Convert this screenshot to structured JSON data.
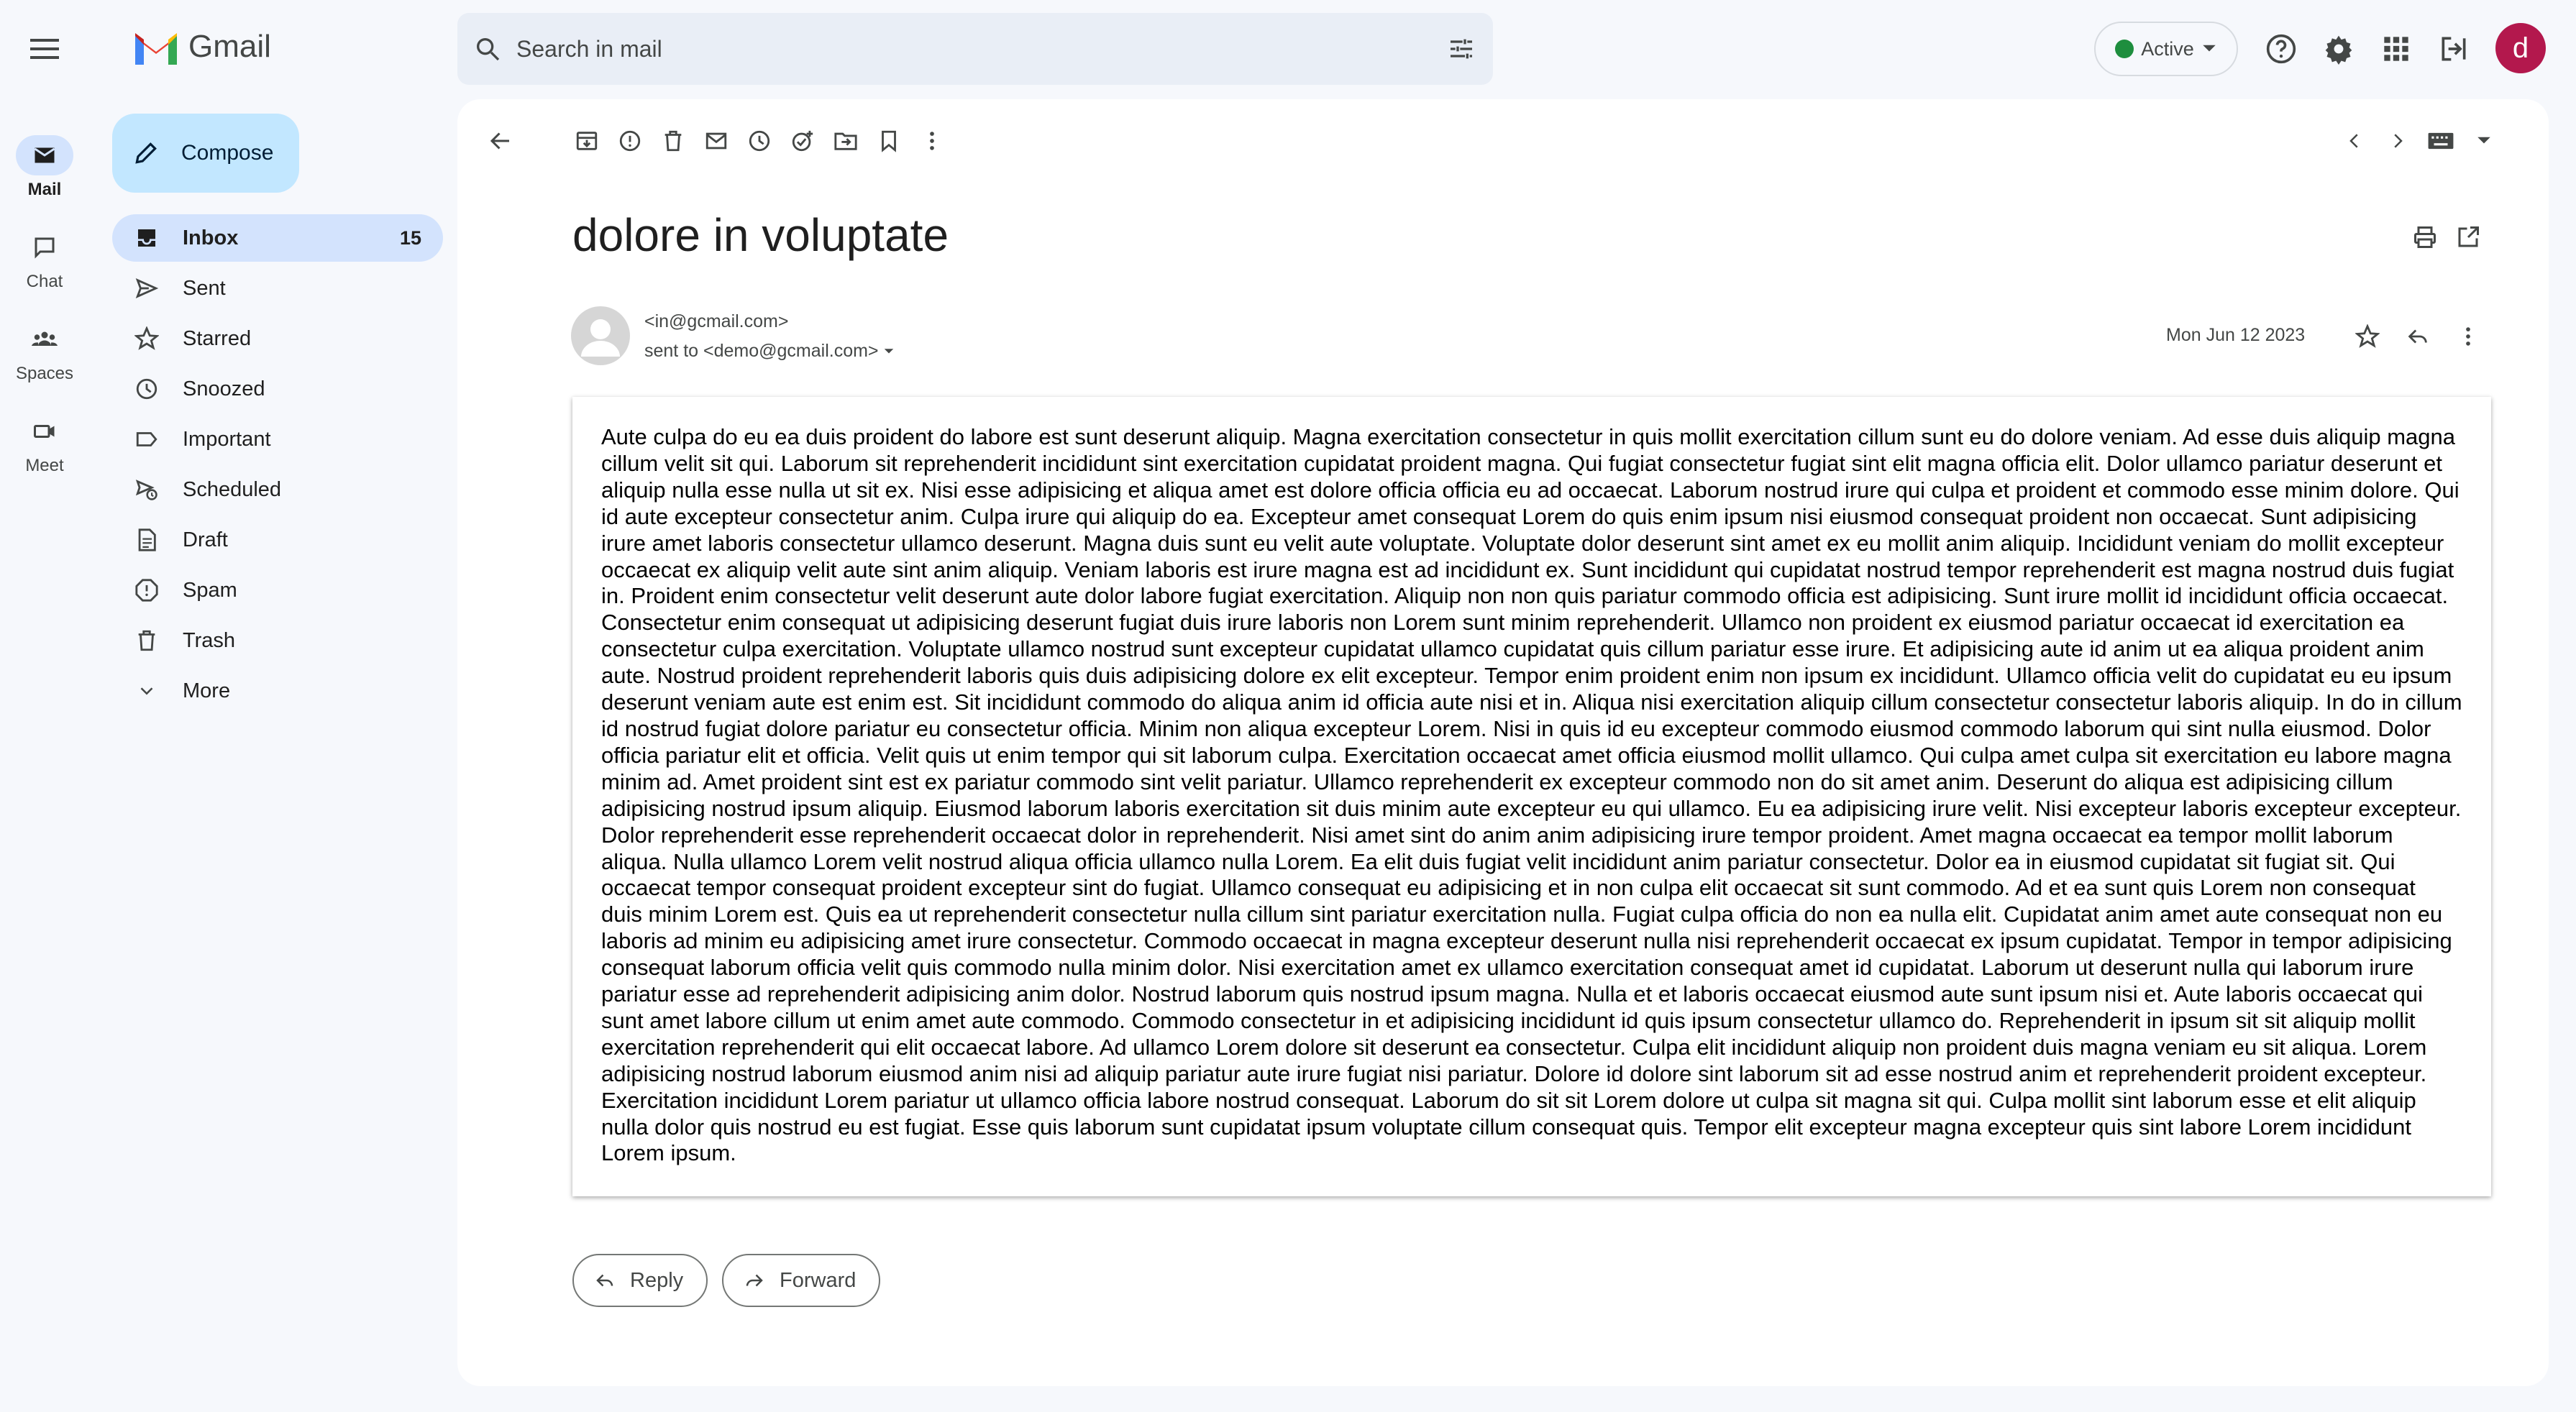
{
  "app": {
    "name": "Gmail"
  },
  "rail": [
    {
      "label": "Mail",
      "icon": "mail-icon",
      "active": true
    },
    {
      "label": "Chat",
      "icon": "chat-icon",
      "active": false
    },
    {
      "label": "Spaces",
      "icon": "spaces-icon",
      "active": false
    },
    {
      "label": "Meet",
      "icon": "video-icon",
      "active": false
    }
  ],
  "search": {
    "placeholder": "Search in mail"
  },
  "status": {
    "label": "Active",
    "color": "#1e8e3e"
  },
  "account": {
    "initial": "d",
    "color": "#b3184d"
  },
  "compose": {
    "label": "Compose"
  },
  "nav": {
    "inbox": {
      "label": "Inbox",
      "count": "15"
    },
    "sent": {
      "label": "Sent"
    },
    "starred": {
      "label": "Starred"
    },
    "snoozed": {
      "label": "Snoozed"
    },
    "important": {
      "label": "Important"
    },
    "scheduled": {
      "label": "Scheduled"
    },
    "draft": {
      "label": "Draft"
    },
    "spam": {
      "label": "Spam"
    },
    "trash": {
      "label": "Trash"
    },
    "more": {
      "label": "More"
    }
  },
  "email": {
    "subject": "dolore in voluptate",
    "from": "<in@gcmail.com>",
    "to": "sent to <demo@gcmail.com>",
    "date": "Mon Jun 12 2023",
    "body": "Aute culpa do eu ea duis proident do labore est sunt deserunt aliquip. Magna exercitation consectetur in quis mollit exercitation cillum sunt eu do dolore veniam. Ad esse duis aliquip magna cillum velit sit qui. Laborum sit reprehenderit incididunt sint exercitation cupidatat proident magna. Qui fugiat consectetur fugiat sint elit magna officia elit. Dolor ullamco pariatur deserunt et aliquip nulla esse nulla ut sit ex. Nisi esse adipisicing et aliqua amet est dolore officia officia eu ad occaecat. Laborum nostrud irure qui culpa et proident et commodo esse minim dolore. Qui id aute excepteur consectetur anim. Culpa irure qui aliquip do ea. Excepteur amet consequat Lorem do quis enim ipsum nisi eiusmod consequat proident non occaecat. Sunt adipisicing irure amet laboris consectetur ullamco deserunt. Magna duis sunt eu velit aute voluptate. Voluptate dolor deserunt sint amet ex eu mollit anim aliquip. Incididunt veniam do mollit excepteur occaecat ex aliquip velit aute sint anim aliquip. Veniam laboris est irure magna est ad incididunt ex. Sunt incididunt qui cupidatat nostrud tempor reprehenderit est magna nostrud duis fugiat in. Proident enim consectetur velit deserunt aute dolor labore fugiat exercitation. Aliquip non non quis pariatur commodo officia est adipisicing. Sunt irure mollit id incididunt officia occaecat. Consectetur enim consequat ut adipisicing deserunt fugiat duis irure laboris non Lorem sunt minim reprehenderit. Ullamco non proident ex eiusmod pariatur occaecat id exercitation ea consectetur culpa exercitation. Voluptate ullamco nostrud sunt excepteur cupidatat ullamco cupidatat quis cillum pariatur esse irure. Et adipisicing aute id anim ut ea aliqua proident anim aute. Nostrud proident reprehenderit laboris quis duis adipisicing dolore ex elit excepteur. Tempor enim proident enim non ipsum ex incididunt. Ullamco officia velit do cupidatat eu eu ipsum deserunt veniam aute est enim est. Sit incididunt commodo do aliqua anim id officia aute nisi et in. Aliqua nisi exercitation aliquip cillum consectetur consectetur laboris aliquip. In do in cillum id nostrud fugiat dolore pariatur eu consectetur officia. Minim non aliqua excepteur Lorem. Nisi in quis id eu excepteur commodo eiusmod commodo laborum qui sint nulla eiusmod. Dolor officia pariatur elit et officia. Velit quis ut enim tempor qui sit laborum culpa. Exercitation occaecat amet officia eiusmod mollit ullamco. Qui culpa amet culpa sit exercitation eu labore magna minim ad. Amet proident sint est ex pariatur commodo sint velit pariatur. Ullamco reprehenderit ex excepteur commodo non do sit amet anim. Deserunt do aliqua est adipisicing cillum adipisicing nostrud ipsum aliquip. Eiusmod laborum laboris exercitation sit duis minim aute excepteur eu qui ullamco. Eu ea adipisicing irure velit. Nisi excepteur laboris excepteur excepteur. Dolor reprehenderit esse reprehenderit occaecat dolor in reprehenderit. Nisi amet sint do anim anim adipisicing irure tempor proident. Amet magna occaecat ea tempor mollit laborum aliqua. Nulla ullamco Lorem velit nostrud aliqua officia ullamco nulla Lorem. Ea elit duis fugiat velit incididunt anim pariatur consectetur. Dolor ea in eiusmod cupidatat sit fugiat sit. Qui occaecat tempor consequat proident excepteur sint do fugiat. Ullamco consequat eu adipisicing et in non culpa elit occaecat sit sunt commodo. Ad et ea sunt quis Lorem non consequat duis minim Lorem est. Quis ea ut reprehenderit consectetur nulla cillum sint pariatur exercitation nulla. Fugiat culpa officia do non ea nulla elit. Cupidatat anim amet aute consequat non eu laboris ad minim eu adipisicing amet irure consectetur. Commodo occaecat in magna excepteur deserunt nulla nisi reprehenderit occaecat ex ipsum cupidatat. Tempor in tempor adipisicing consequat laborum officia velit quis commodo nulla minim dolor. Nisi exercitation amet ex ullamco exercitation consequat amet id cupidatat. Laborum ut deserunt nulla qui laborum irure pariatur esse ad reprehenderit adipisicing anim dolor. Nostrud laborum quis nostrud ipsum magna. Nulla et et laboris occaecat eiusmod aute sunt ipsum nisi et. Aute laboris occaecat qui sunt amet labore cillum ut enim amet aute commodo. Commodo consectetur in et adipisicing incididunt id quis ipsum consectetur ullamco do. Reprehenderit in ipsum sit sit aliquip mollit exercitation reprehenderit qui elit occaecat labore. Ad ullamco Lorem dolore sit deserunt ea consectetur. Culpa elit incididunt aliquip non proident duis magna veniam eu sit aliqua. Lorem adipisicing nostrud laborum eiusmod anim nisi ad aliquip pariatur aute irure fugiat nisi pariatur. Dolore id dolore sint laborum sit ad esse nostrud anim et reprehenderit proident excepteur. Exercitation incididunt Lorem pariatur ut ullamco officia labore nostrud consequat. Laborum do sit sit Lorem dolore ut culpa sit magna sit qui. Culpa mollit sint laborum esse et elit aliquip nulla dolor quis nostrud eu est fugiat. Esse quis laborum sunt cupidatat ipsum voluptate cillum consequat quis. Tempor elit excepteur magna excepteur quis sint labore Lorem incididunt Lorem ipsum."
  },
  "actions": {
    "reply": "Reply",
    "forward": "Forward"
  }
}
